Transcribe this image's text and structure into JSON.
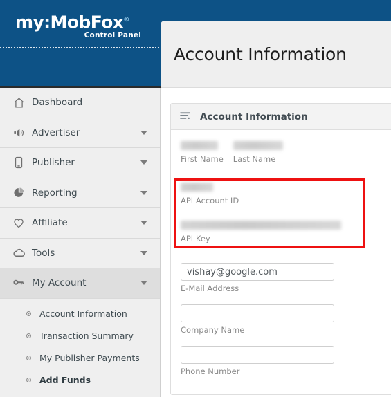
{
  "brand": {
    "name": "my:MobFox",
    "registered_mark": "®",
    "subtitle": "Control Panel"
  },
  "sidebar": {
    "items": [
      {
        "label": "Dashboard",
        "icon": "home-icon",
        "has_caret": false,
        "active": false
      },
      {
        "label": "Advertiser",
        "icon": "megaphone-icon",
        "has_caret": true,
        "active": false
      },
      {
        "label": "Publisher",
        "icon": "mobile-icon",
        "has_caret": true,
        "active": false
      },
      {
        "label": "Reporting",
        "icon": "pie-chart-icon",
        "has_caret": true,
        "active": false
      },
      {
        "label": "Affiliate",
        "icon": "heart-icon",
        "has_caret": true,
        "active": false
      },
      {
        "label": "Tools",
        "icon": "cloud-icon",
        "has_caret": true,
        "active": false
      },
      {
        "label": "My Account",
        "icon": "key-icon",
        "has_caret": true,
        "active": true
      }
    ],
    "submenu": [
      {
        "label": "Account Information",
        "current": false
      },
      {
        "label": "Transaction Summary",
        "current": false
      },
      {
        "label": "My Publisher Payments",
        "current": false
      },
      {
        "label": "Add Funds",
        "current": true
      }
    ]
  },
  "page": {
    "title": "Account Information"
  },
  "panel": {
    "icon": "list-lines-icon",
    "title": "Account Information",
    "fields": {
      "first_name_label": "First Name",
      "last_name_label": "Last Name",
      "api_account_id_label": "API Account ID",
      "api_key_label": "API Key",
      "email_label": "E-Mail Address",
      "email_value": "vishay@google.com",
      "email_placeholder": "",
      "company_label": "Company Name",
      "company_value": "",
      "company_placeholder": "",
      "phone_label": "Phone Number",
      "phone_value": "",
      "phone_placeholder": ""
    }
  },
  "annotation": {
    "type": "red-rectangle-highlight",
    "color": "#ee1111",
    "targets": "API Account ID and API Key"
  },
  "colors": {
    "brand_blue": "#0d5286",
    "sidebar_bg": "#efefef",
    "sidebar_active": "#dedede",
    "header_bg": "#efefef",
    "highlight_red": "#ee1111",
    "text_dark": "#3f4b51",
    "label_gray": "#8a8a8a"
  }
}
